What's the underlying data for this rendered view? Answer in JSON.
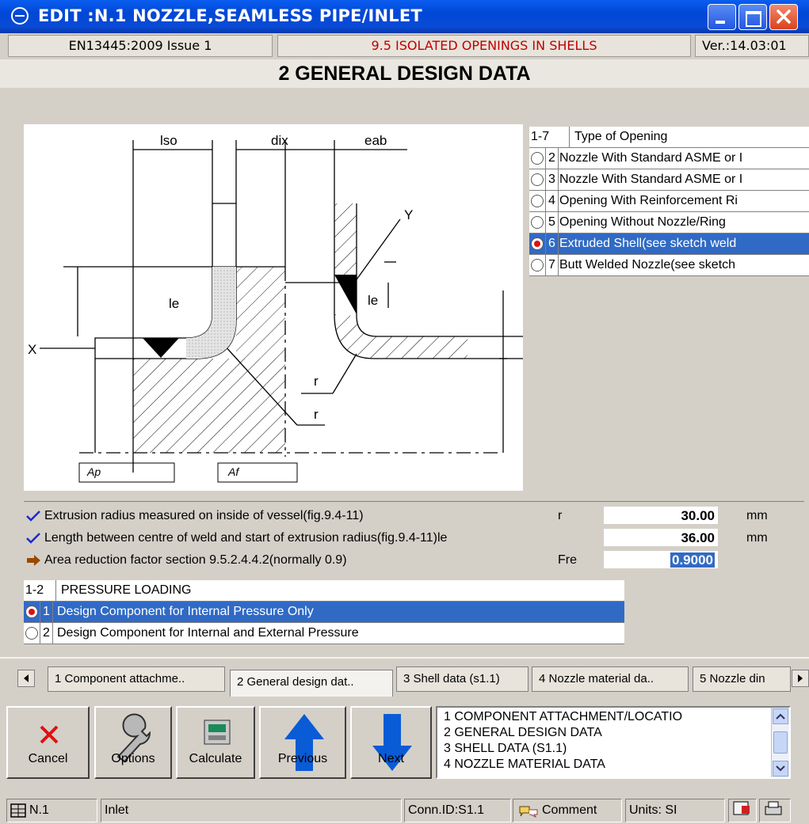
{
  "window": {
    "title": "EDIT :N.1 NOZZLE,SEAMLESS PIPE/INLET"
  },
  "header": {
    "standard": "EN13445:2009 Issue 1",
    "clause": "9.5 ISOLATED OPENINGS IN SHELLS",
    "version": "Ver.:14.03:01"
  },
  "section_title": "2 GENERAL DESIGN DATA",
  "sketch": {
    "labels": {
      "lso": "lso",
      "dix": "dix",
      "eab": "eab",
      "y": "Y",
      "x": "X",
      "le_left": "le",
      "le_right": "le",
      "r_top": "r",
      "r_bottom": "r",
      "ap": "Ap",
      "af": "Af"
    }
  },
  "opening_type": {
    "range": "1-7",
    "header": "Type of Opening",
    "items": [
      {
        "num": "2",
        "label": "Nozzle With Standard ASME or I",
        "selected": false
      },
      {
        "num": "3",
        "label": "Nozzle With Standard ASME or I",
        "selected": false
      },
      {
        "num": "4",
        "label": "Opening With Reinforcement Ri",
        "selected": false
      },
      {
        "num": "5",
        "label": "Opening Without Nozzle/Ring",
        "selected": false
      },
      {
        "num": "6",
        "label": "Extruded Shell(see sketch weld",
        "selected": true
      },
      {
        "num": "7",
        "label": "Butt Welded Nozzle(see sketch",
        "selected": false
      }
    ]
  },
  "params": [
    {
      "label": "Extrusion radius measured on inside of vessel(fig.9.4-11)",
      "symbol": "r",
      "value": "30.00",
      "unit": "mm",
      "icon": "check-icon"
    },
    {
      "label": "Length between centre of weld and start of extrusion radius(fig.9.4-11)le",
      "symbol": "",
      "value": "36.00",
      "unit": "mm",
      "icon": "check-icon"
    },
    {
      "label": "Area reduction factor section 9.5.2.4.4.2(normally 0.9)",
      "symbol": "Fre",
      "value": "0.9000",
      "unit": "",
      "icon": "arrow-right-icon"
    }
  ],
  "pressure_loading": {
    "range": "1-2",
    "header": "PRESSURE LOADING",
    "items": [
      {
        "num": "1",
        "label": "Design Component for Internal Pressure Only",
        "selected": true
      },
      {
        "num": "2",
        "label": "Design Component for Internal and External Pressure",
        "selected": false
      }
    ]
  },
  "tabs": [
    {
      "label": "1 Component attachme.."
    },
    {
      "label": "2 General design dat.."
    },
    {
      "label": "3 Shell data (s1.1)"
    },
    {
      "label": "4 Nozzle material da.."
    },
    {
      "label": "5 Nozzle din"
    }
  ],
  "toolbar": {
    "cancel": "Cancel",
    "options": "Options",
    "calculate": "Calculate",
    "previous": "Previous",
    "next": "Next"
  },
  "nav_list": [
    "1 COMPONENT ATTACHMENT/LOCATIO",
    "2 GENERAL DESIGN DATA",
    "3 SHELL DATA (S1.1)",
    "4 NOZZLE MATERIAL DATA"
  ],
  "statusbar": {
    "id": "N.1",
    "name": "Inlet",
    "conn": "Conn.ID:S1.1",
    "comment": "Comment",
    "units": "Units: SI"
  },
  "colors": {
    "title_blue": "#0047d6",
    "selection": "#316ac5",
    "clause_red": "#c00000",
    "arrow_blue": "#0a5bd6",
    "cancel_red": "#e01010"
  }
}
